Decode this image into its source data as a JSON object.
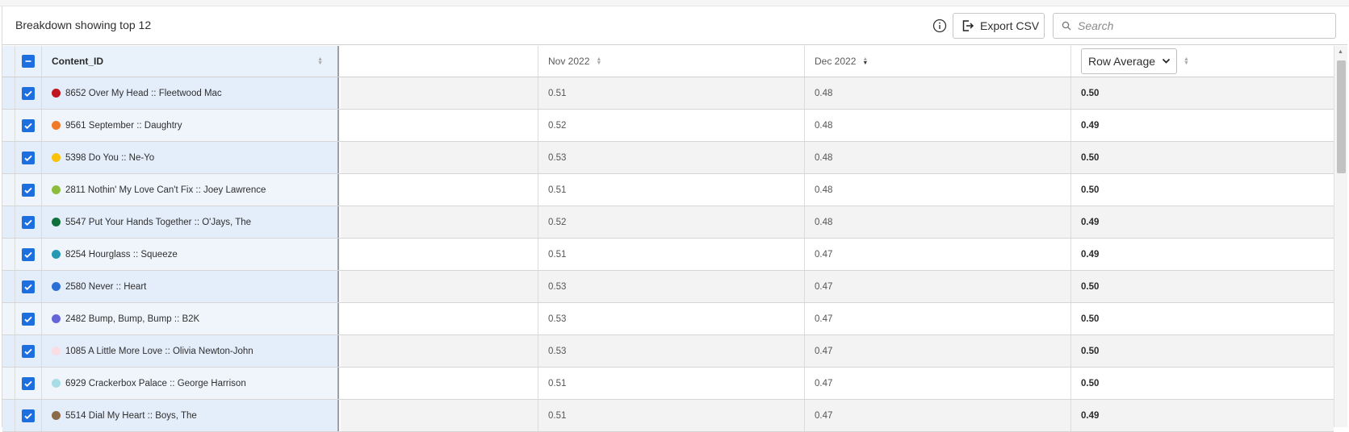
{
  "header": {
    "title": "Breakdown showing top 12",
    "export_label": "Export CSV",
    "search_placeholder": "Search"
  },
  "columns": {
    "content_id": "Content_ID",
    "nov": "Nov 2022",
    "dec": "Dec 2022",
    "avg_select": "Row Average"
  },
  "rows": [
    {
      "label": "8652 Over My Head :: Fleetwood Mac",
      "color": "#c0141e",
      "nov": "0.51",
      "dec": "0.48",
      "avg": "0.50"
    },
    {
      "label": "9561 September :: Daughtry",
      "color": "#f07a28",
      "nov": "0.52",
      "dec": "0.48",
      "avg": "0.49"
    },
    {
      "label": "5398 Do You :: Ne-Yo",
      "color": "#f7c10c",
      "nov": "0.53",
      "dec": "0.48",
      "avg": "0.50"
    },
    {
      "label": "2811 Nothin' My Love Can't Fix :: Joey Lawrence",
      "color": "#8cbd3b",
      "nov": "0.51",
      "dec": "0.48",
      "avg": "0.50"
    },
    {
      "label": "5547 Put Your Hands Together :: O'Jays, The",
      "color": "#10703c",
      "nov": "0.52",
      "dec": "0.48",
      "avg": "0.49"
    },
    {
      "label": "8254 Hourglass :: Squeeze",
      "color": "#2599b3",
      "nov": "0.51",
      "dec": "0.47",
      "avg": "0.49"
    },
    {
      "label": "2580 Never :: Heart",
      "color": "#2b6fd6",
      "nov": "0.53",
      "dec": "0.47",
      "avg": "0.50"
    },
    {
      "label": "2482 Bump, Bump, Bump :: B2K",
      "color": "#6466d8",
      "nov": "0.53",
      "dec": "0.47",
      "avg": "0.50"
    },
    {
      "label": "1085 A Little More Love :: Olivia Newton-John",
      "color": "#f9dde3",
      "nov": "0.53",
      "dec": "0.47",
      "avg": "0.50"
    },
    {
      "label": "6929 Crackerbox Palace :: George Harrison",
      "color": "#a8dde6",
      "nov": "0.51",
      "dec": "0.47",
      "avg": "0.50"
    },
    {
      "label": "5514 Dial My Heart :: Boys, The",
      "color": "#8b6a4a",
      "nov": "0.51",
      "dec": "0.47",
      "avg": "0.49"
    }
  ]
}
